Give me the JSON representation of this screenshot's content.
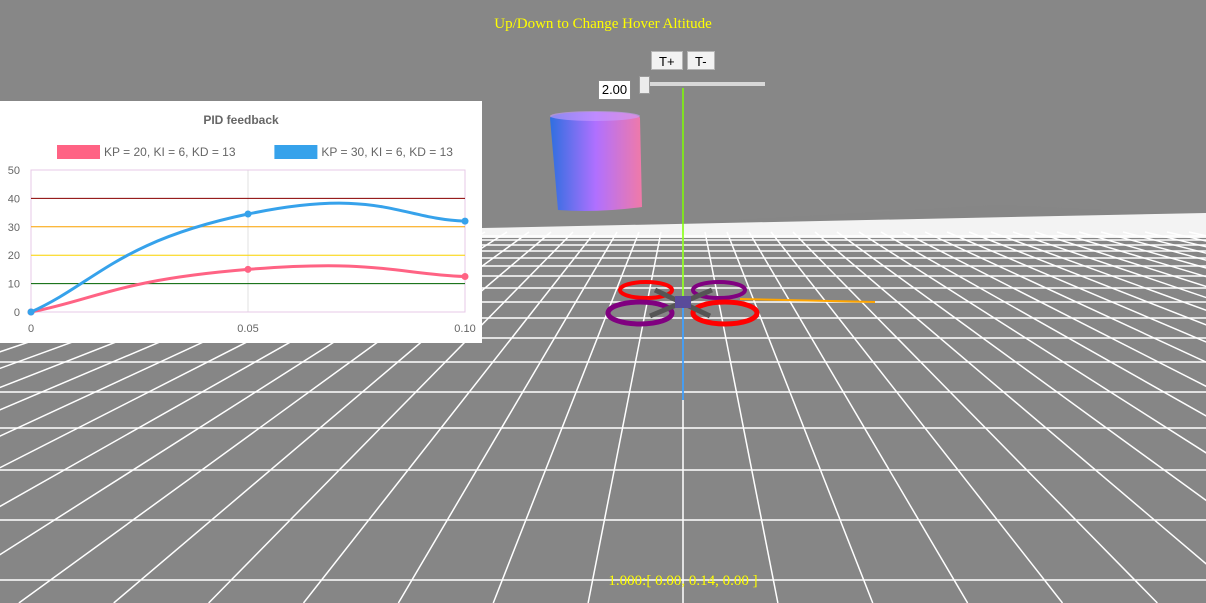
{
  "hud": {
    "instruction": "Up/Down to Change Hover Altitude",
    "status": "1.000:[ 0.00, 0.14, 0.00 ]"
  },
  "controls": {
    "thrust_up_label": "T+",
    "thrust_down_label": "T-",
    "altitude_value": "2.00",
    "altitude_slider_level": 0.02
  },
  "scene": {
    "background_color": "#878787",
    "floor_grid_color": "#ffffff",
    "cylinder_gradient": [
      "#2f6fe0",
      "#b070ff",
      "#f07aa8"
    ],
    "drone_ring_colors": [
      "#ff0000",
      "#800080"
    ],
    "axis_colors": {
      "x": "#ffa500",
      "y": "#00ff00",
      "z": "#1e90ff"
    }
  },
  "chart_data": {
    "type": "line",
    "title": "PID feedback",
    "legend_position": "top",
    "x": [
      0,
      0.05,
      0.1
    ],
    "x_ticks": [
      "0",
      "0.05",
      "0.10"
    ],
    "ylim": [
      0,
      50
    ],
    "y_ticks": [
      "0",
      "10",
      "20",
      "30",
      "40",
      "50"
    ],
    "ref_lines": [
      {
        "y": 10,
        "color": "#006400"
      },
      {
        "y": 20,
        "color": "#ffd700"
      },
      {
        "y": 30,
        "color": "#ffa500"
      },
      {
        "y": 40,
        "color": "#8b0000"
      }
    ],
    "series": [
      {
        "name": "KP = 20, KI = 6, KD = 13",
        "color": "#ff6384",
        "values": [
          0,
          15,
          12.5
        ]
      },
      {
        "name": "KP = 30, KI = 6, KD = 13",
        "color": "#36a2eb",
        "values": [
          0,
          34.5,
          32
        ]
      }
    ]
  }
}
